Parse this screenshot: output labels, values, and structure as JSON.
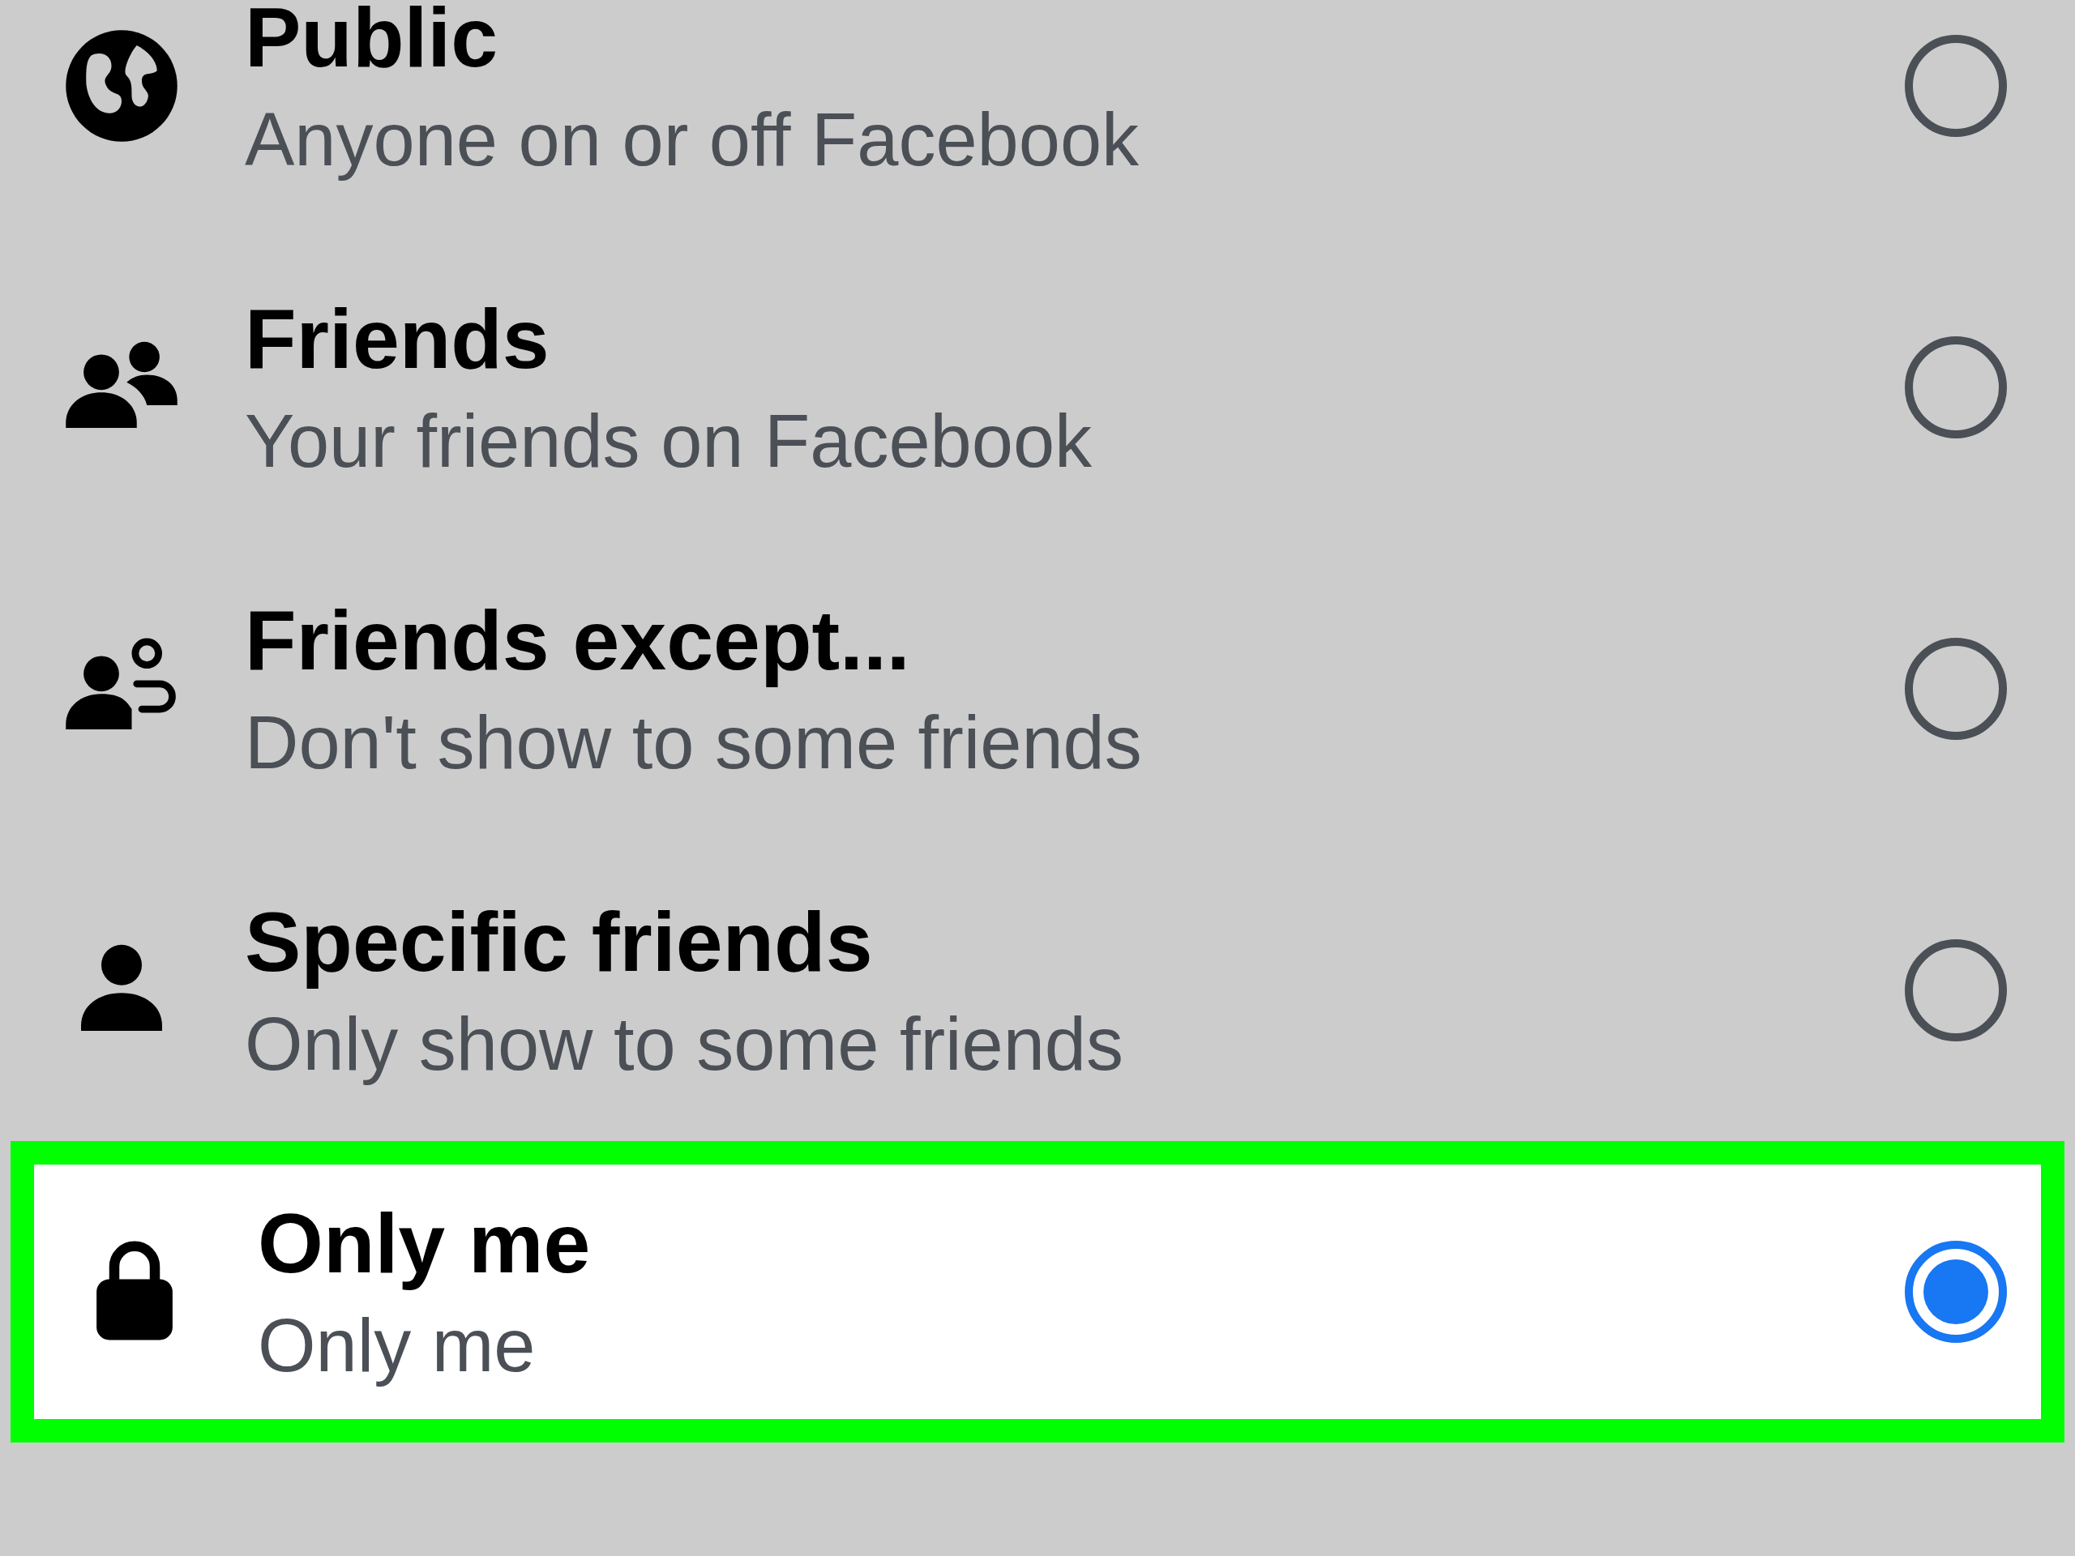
{
  "options": [
    {
      "kind": "public",
      "title": "Public",
      "subtitle": "Anyone on or off Facebook",
      "selected": false,
      "highlighted": false
    },
    {
      "kind": "friends",
      "title": "Friends",
      "subtitle": "Your friends on Facebook",
      "selected": false,
      "highlighted": false
    },
    {
      "kind": "except",
      "title": "Friends except...",
      "subtitle": "Don't show to some friends",
      "selected": false,
      "highlighted": false
    },
    {
      "kind": "specific",
      "title": "Specific friends",
      "subtitle": "Only show to some friends",
      "selected": false,
      "highlighted": false
    },
    {
      "kind": "private",
      "title": "Only me",
      "subtitle": "Only me",
      "selected": true,
      "highlighted": true
    }
  ]
}
